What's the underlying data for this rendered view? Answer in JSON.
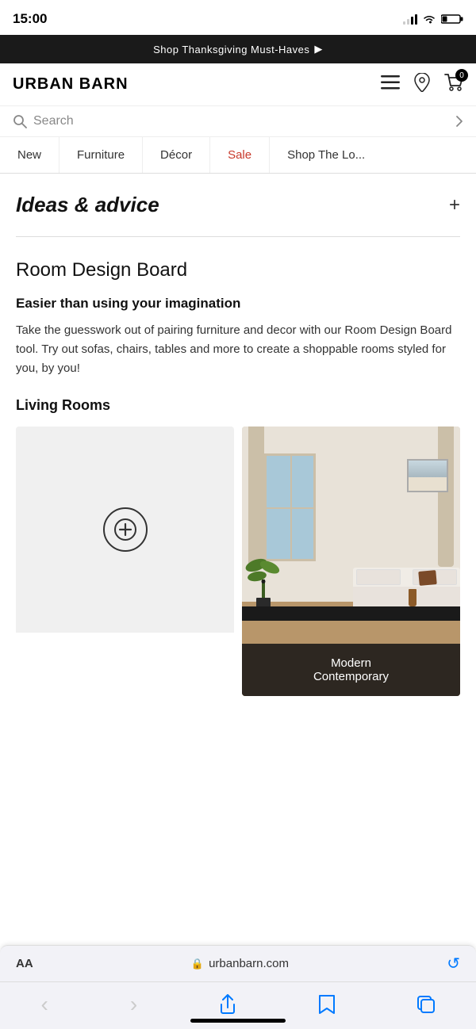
{
  "statusBar": {
    "time": "15:00",
    "locationIcon": "◂"
  },
  "announcement": {
    "text": "Shop Thanksgiving Must-Haves",
    "arrow": "▶"
  },
  "header": {
    "logo": "URBAN BARN",
    "cartCount": "0"
  },
  "search": {
    "placeholder": "Search"
  },
  "nav": {
    "tabs": [
      {
        "label": "New",
        "type": "normal"
      },
      {
        "label": "Furniture",
        "type": "normal"
      },
      {
        "label": "Décor",
        "type": "normal"
      },
      {
        "label": "Sale",
        "type": "sale"
      },
      {
        "label": "Shop The Lo...",
        "type": "normal"
      }
    ]
  },
  "ideasSection": {
    "title": "Ideas & advice",
    "toggleIcon": "+"
  },
  "roomDesign": {
    "title": "Room Design Board",
    "subtitle": "Easier than using your imagination",
    "description": "Take the guesswork out of pairing furniture and decor with our Room Design Board tool. Try out sofas, chairs, tables and more to create a shoppable rooms styled for you, by you!",
    "livingRoomsLabel": "Living Rooms",
    "addCardIcon": "⊕",
    "card1Caption": "Modern\nContemporary"
  },
  "browserBar": {
    "aa": "AA",
    "lockIcon": "🔒",
    "url": "urbanbarn.com"
  },
  "browserToolbar": {
    "back": "‹",
    "forward": "›",
    "share": "↑",
    "bookmarks": "📖",
    "tabs": "⧉"
  }
}
